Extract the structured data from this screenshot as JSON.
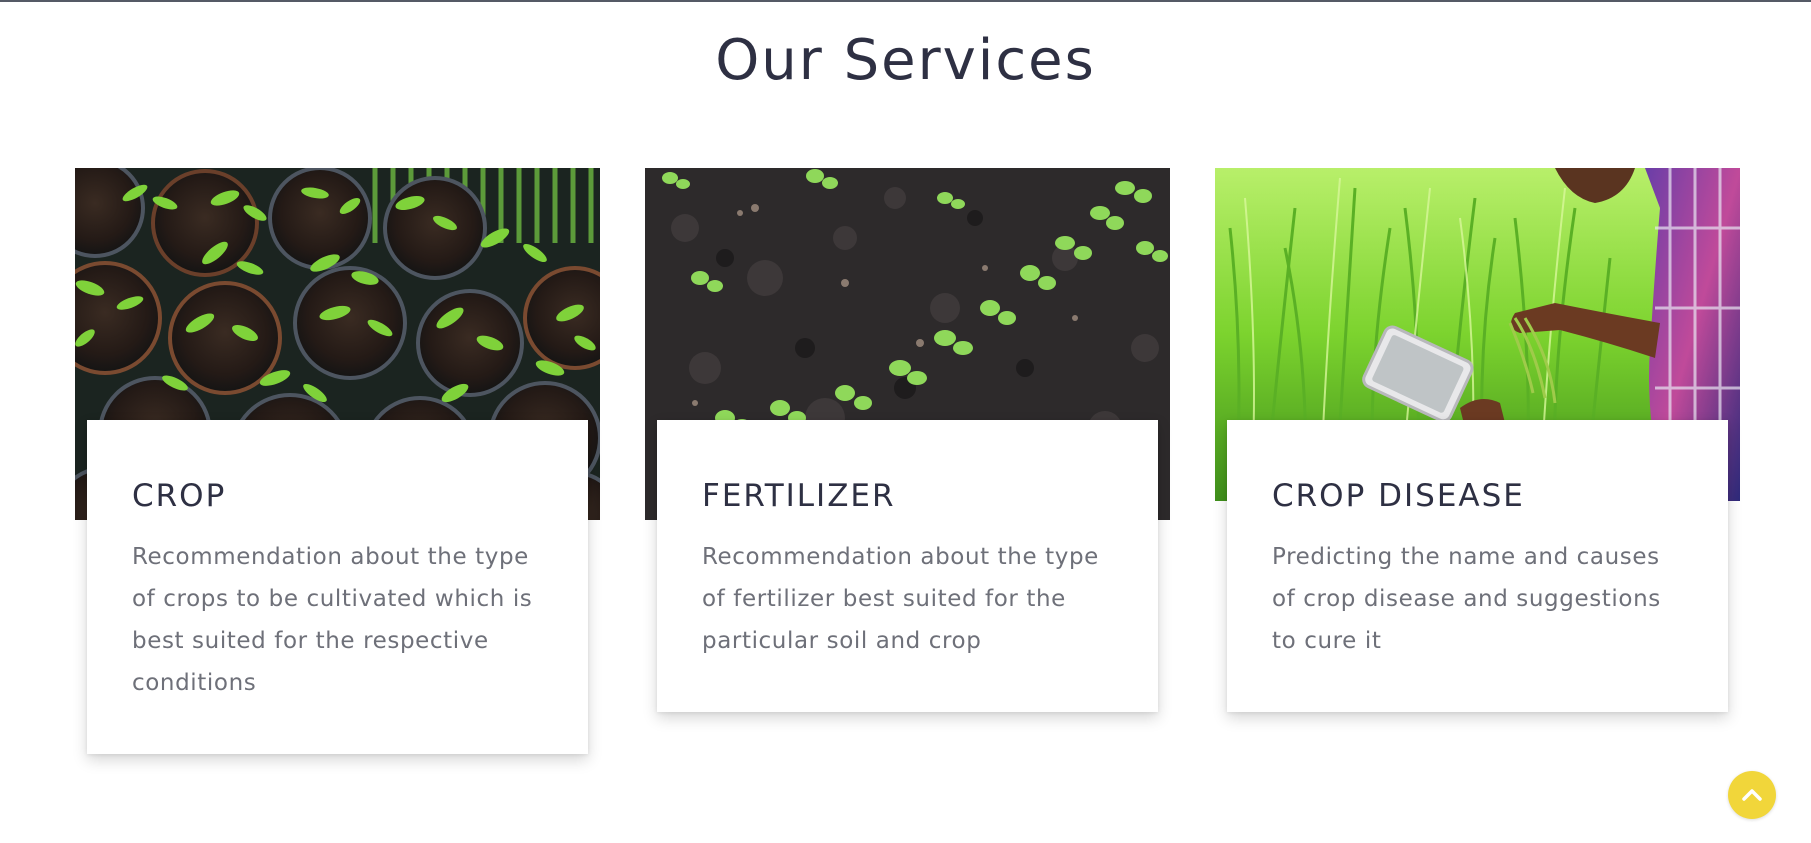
{
  "section": {
    "title": "Our Services"
  },
  "services": [
    {
      "title": "CROP",
      "description": "Recommendation about the type of crops to be cultivated which is best suited for the respective conditions",
      "image_icon": "seedlings-in-pots-photo"
    },
    {
      "title": "FERTILIZER",
      "description": "Recommendation about the type of fertilizer best suited for the particular soil and crop",
      "image_icon": "sprouts-in-soil-photo"
    },
    {
      "title": "CROP DISEASE",
      "description": "Predicting the name and causes of crop disease and suggestions to cure it",
      "image_icon": "farmer-with-tablet-photo"
    }
  ],
  "scroll_top": {
    "icon": "chevron-up-icon",
    "color": "#f1d63a"
  },
  "colors": {
    "heading": "#2e3043",
    "body_text": "#6e7079",
    "accent": "#f1d63a"
  }
}
